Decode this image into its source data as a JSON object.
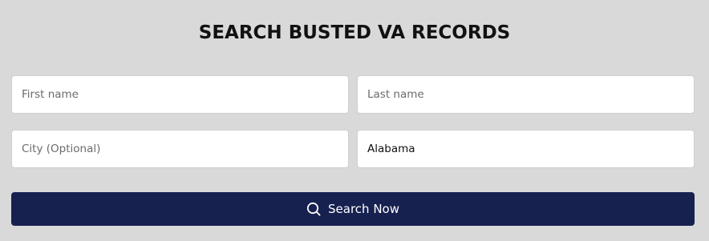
{
  "header": {
    "title": "SEARCH BUSTED VA RECORDS"
  },
  "form": {
    "first_name": {
      "placeholder": "First name",
      "value": ""
    },
    "last_name": {
      "placeholder": "Last name",
      "value": ""
    },
    "city": {
      "placeholder": "City (Optional)",
      "value": ""
    },
    "state": {
      "value": "Alabama"
    },
    "search_button": {
      "label": "Search Now",
      "icon": "search-icon"
    }
  },
  "colors": {
    "background": "#d9d9d9",
    "button": "#172150",
    "button_text": "#ffffff"
  }
}
